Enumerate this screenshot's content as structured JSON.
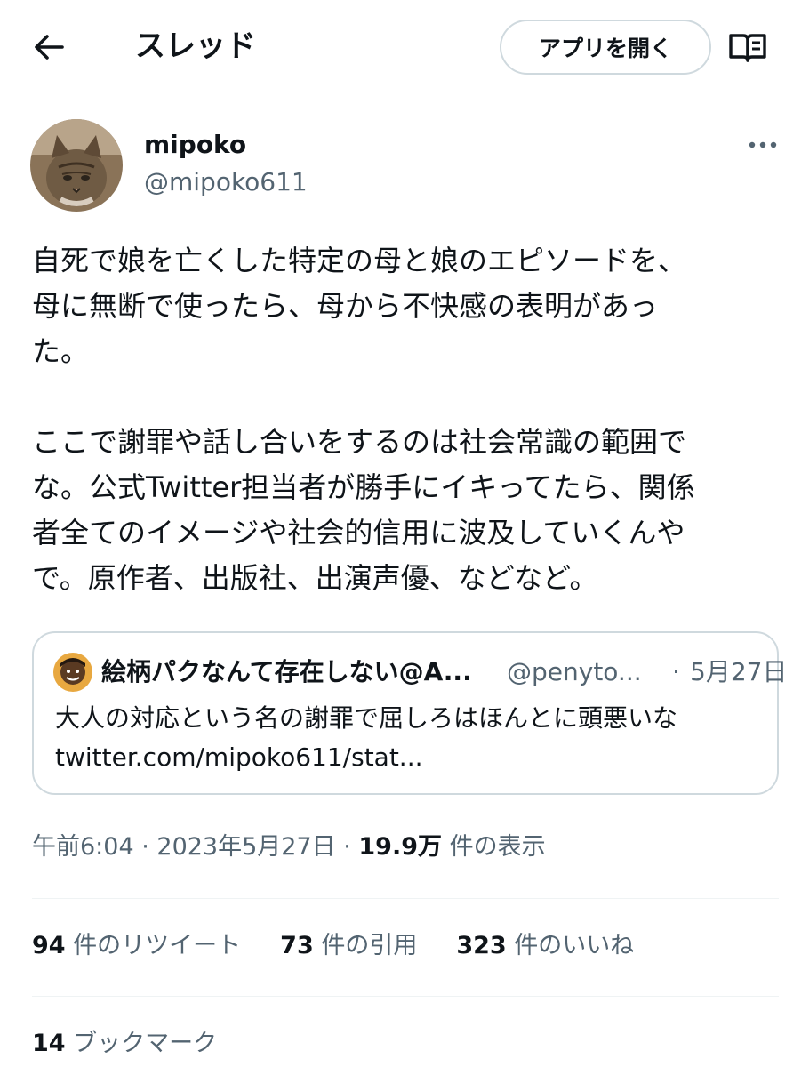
{
  "header": {
    "back_icon": "arrow-left-icon",
    "title": "スレッド",
    "open_app_label": "アプリを開く",
    "reader_icon": "open-book-icon"
  },
  "author": {
    "name": "mipoko",
    "handle": "@mipoko611",
    "avatar_icon": "cat-avatar",
    "more_icon": "more-horizontal-icon"
  },
  "tweet": {
    "text": "自死で娘を亡くした特定の母と娘のエピソードを、\n母に無断で使ったら、母から不快感の表明があっ\nた。\n\nここで謝罪や話し合いをするのは社会常識の範囲で\nな。公式Twitter担当者が勝手にイキってたら、関係\n者全てのイメージや社会的信用に波及していくんや\nで。原作者、出版社、出演声優、などなど。"
  },
  "quote": {
    "name": "絵柄パクなんて存在しない@A...",
    "handle": "@penyto...",
    "separator": "·",
    "date": "5月27日",
    "text": "大人の対応という名の謝罪で屈しろはほんとに頭悪いな\ntwitter.com/mipoko611/stat..."
  },
  "meta": {
    "time": "午前6:04",
    "sep1": " · ",
    "date": "2023年5月27日",
    "sep2": " · ",
    "views": "19.9万",
    "views_label": " 件の表示"
  },
  "stats": {
    "retweets": "94",
    "retweets_label": " 件のリツイート",
    "quotes": "73",
    "quotes_label": " 件の引用",
    "likes": "323",
    "likes_label": " 件のいいね"
  },
  "bookmarks": {
    "count": "14",
    "label": " ブックマーク"
  }
}
